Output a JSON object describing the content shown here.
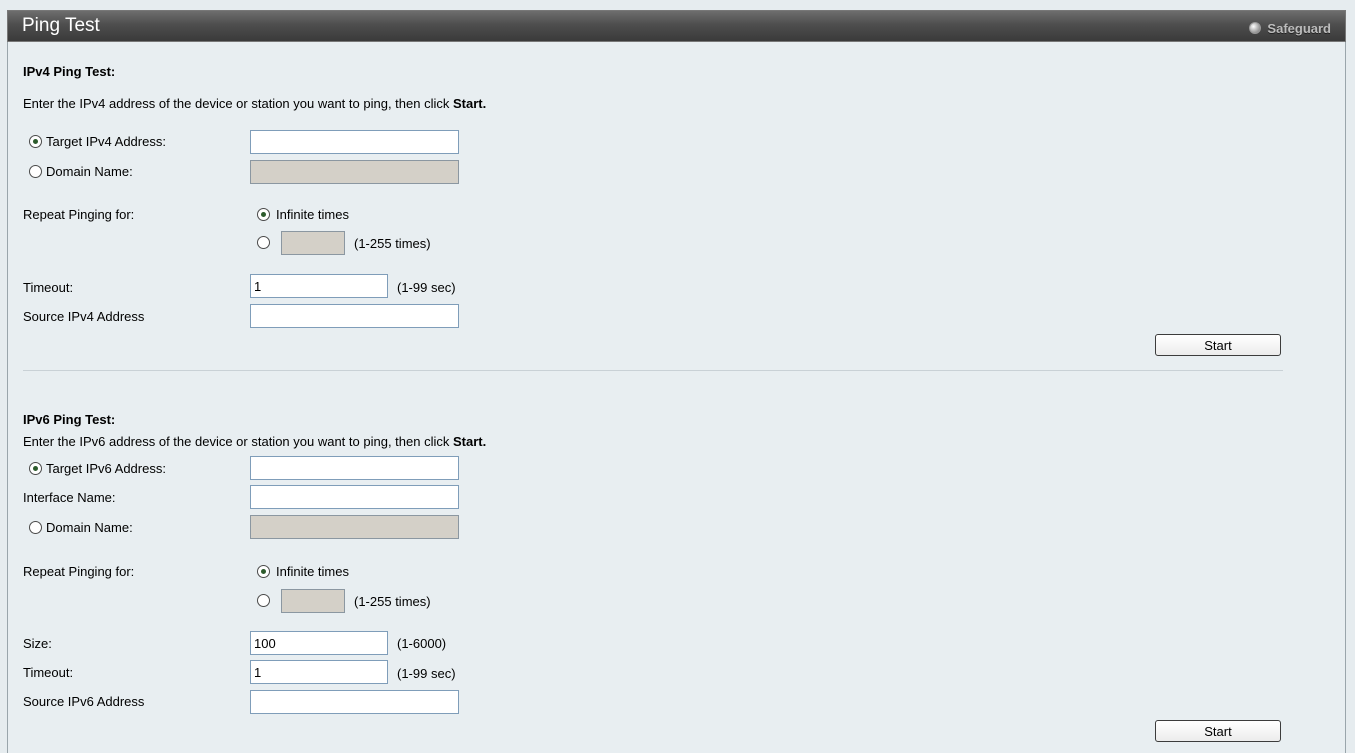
{
  "header": {
    "title": "Ping Test",
    "safeguard": "Safeguard"
  },
  "ipv4": {
    "heading": "IPv4 Ping Test:",
    "instr_prefix": "Enter the IPv4 address of the device or station you want to ping, then click ",
    "instr_bold": "Start.",
    "target_label": "Target IPv4 Address:",
    "target_value": "",
    "domain_label": "Domain Name:",
    "domain_value": "",
    "repeat_label": "Repeat Pinging for:",
    "infinite_label": "Infinite times",
    "count_value": "",
    "count_range": "(1-255 times)",
    "timeout_label": "Timeout:",
    "timeout_value": "1",
    "timeout_range": "(1-99 sec)",
    "source_label": "Source IPv4 Address",
    "source_value": "",
    "start_label": "Start"
  },
  "ipv6": {
    "heading": "IPv6 Ping Test:",
    "instr_prefix": "Enter the IPv6 address of the device or station you want to ping, then click ",
    "instr_bold": "Start.",
    "target_label": "Target IPv6 Address:",
    "target_value": "",
    "interface_label": "Interface Name:",
    "interface_value": "",
    "domain_label": "Domain Name:",
    "domain_value": "",
    "repeat_label": "Repeat Pinging for:",
    "infinite_label": "Infinite times",
    "count_value": "",
    "count_range": "(1-255 times)",
    "size_label": "Size:",
    "size_value": "100",
    "size_range": "(1-6000)",
    "timeout_label": "Timeout:",
    "timeout_value": "1",
    "timeout_range": "(1-99 sec)",
    "source_label": "Source IPv6 Address",
    "source_value": "",
    "start_label": "Start"
  }
}
